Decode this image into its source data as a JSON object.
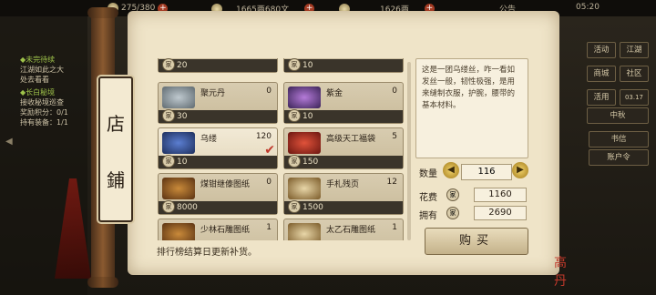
{
  "top_bar": {
    "stamina": "275/380",
    "money": "1665两680文",
    "silver": "1626两",
    "notice_label": "公告",
    "time": "05:20"
  },
  "left_panel": {
    "items": [
      {
        "text": "◆未完待续",
        "green": true
      },
      {
        "text": "江湖如此之大",
        "green": false
      },
      {
        "text": "处去看看",
        "green": false
      },
      {
        "text": "◆长白秘境",
        "green": true
      },
      {
        "text": "接收秘境巡查",
        "green": false
      },
      {
        "text": "奖励积分：0/1",
        "green": false
      },
      {
        "text": "持有装备：1/1",
        "green": false
      }
    ]
  },
  "shop_sign": {
    "char1": "店",
    "char2": "鋪"
  },
  "shop": {
    "currency_glyph": "家",
    "items": [
      {
        "name": "",
        "count": "",
        "price": "20"
      },
      {
        "name": "",
        "count": "",
        "price": "10"
      },
      {
        "name": "聚元丹",
        "count": "0",
        "price": "30"
      },
      {
        "name": "紫金",
        "count": "0",
        "price": "10"
      },
      {
        "name": "乌缕",
        "count": "120",
        "price": "10",
        "selected": true
      },
      {
        "name": "高级天工福袋",
        "count": "5",
        "price": "150"
      },
      {
        "name": "煤钳继傣图纸",
        "count": "0",
        "price": "8000"
      },
      {
        "name": "手札残页",
        "count": "12",
        "price": "1500"
      },
      {
        "name": "少林石雕图纸",
        "count": "1",
        "price": ""
      },
      {
        "name": "太乙石雕图纸",
        "count": "1",
        "price": ""
      }
    ],
    "notice": "排行榜结算日更新补货。"
  },
  "detail": {
    "description": "这是一团乌缕丝，咋一看如发丝一般，韧性极强，是用来缝制衣服，护腕，腰带的基本材料。",
    "qty_label": "数量",
    "qty_value": "116",
    "cost_label": "花费",
    "cost_value": "1160",
    "own_label": "拥有",
    "own_value": "2690",
    "buy_label": "购买"
  },
  "right_panel": {
    "buttons": [
      "活动",
      "江湖",
      "商城",
      "社区",
      "活用",
      "中秋",
      "书信",
      "账户令"
    ],
    "date": "03.17"
  },
  "seal_text": "高丹",
  "colors": {
    "accent_red": "#c0392b",
    "paper": "#efe4c8"
  }
}
